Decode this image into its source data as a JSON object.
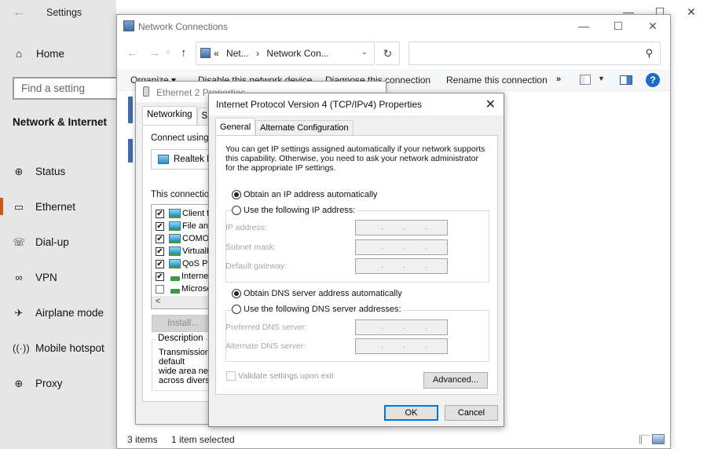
{
  "settings": {
    "title": "Settings",
    "back_icon": "back-arrow-icon",
    "home": {
      "label": "Home",
      "icon": "home-icon"
    },
    "search": {
      "placeholder": "Find a setting"
    },
    "section_title": "Network & Internet",
    "nav": [
      {
        "label": "Status",
        "icon": "globe-monitor-icon",
        "active": false
      },
      {
        "label": "Ethernet",
        "icon": "ethernet-icon",
        "active": true
      },
      {
        "label": "Dial-up",
        "icon": "phone-icon",
        "active": false
      },
      {
        "label": "VPN",
        "icon": "vpn-icon",
        "active": false
      },
      {
        "label": "Airplane mode",
        "icon": "airplane-icon",
        "active": false
      },
      {
        "label": "Mobile hotspot",
        "icon": "hotspot-icon",
        "active": false
      },
      {
        "label": "Proxy",
        "icon": "globe-icon",
        "active": false
      }
    ],
    "accent_color": "#c8581d"
  },
  "network_connections": {
    "title": "Network Connections",
    "window_controls": {
      "minimize": "—",
      "maximize": "☐",
      "close": "✕"
    },
    "nav": {
      "back": "←",
      "forward": "→",
      "recent": "˅",
      "up": "↑"
    },
    "address": {
      "prefix": "«",
      "crumbs": [
        "Net...",
        "›",
        "Network Con..."
      ],
      "dropdown": "⌄",
      "refresh": "↻"
    },
    "search_placeholder": "",
    "commands": {
      "organize": "Organize ▾",
      "disable": "Disable this network device",
      "diagnose": "Diagnose this connection",
      "rename": "Rename this connection",
      "more": "»",
      "help": "?"
    },
    "status": {
      "items": "3 items",
      "selected": "1 item selected"
    }
  },
  "ethernet_properties": {
    "title": "Ethernet 2 Properties",
    "tabs": [
      "Networking",
      "Sharing"
    ],
    "connect_using_label": "Connect using:",
    "adapter": "Realtek PCIe GbE Family Controller",
    "items_label": "This connection uses the following items:",
    "components": [
      {
        "label": "Client for Microsoft Networks",
        "checked": true,
        "type": "net"
      },
      {
        "label": "File and Printer Sharing for Microsoft Networks",
        "checked": true,
        "type": "net"
      },
      {
        "label": "COMODO Internet Security Firewall Driver",
        "checked": true,
        "type": "net"
      },
      {
        "label": "VirtualBox NDIS6 Bridged Networking Driver",
        "checked": true,
        "type": "net"
      },
      {
        "label": "QoS Packet Scheduler",
        "checked": true,
        "type": "net"
      },
      {
        "label": "Internet Protocol Version 4 (TCP/IPv4)",
        "checked": true,
        "type": "proto"
      },
      {
        "label": "Microsoft Network Adapter Multiplexor Protocol",
        "checked": false,
        "type": "proto"
      }
    ],
    "scroll_left": "<",
    "install_button": "Install...",
    "description_label": "Description",
    "description_text": "Transmission Control Protocol/Internet Protocol. The default\nwide area network protocol that provides communication\nacross diverse interconnected networks."
  },
  "ipv4_properties": {
    "title": "Internet Protocol Version 4 (TCP/IPv4) Properties",
    "close": "✕",
    "tabs": [
      "General",
      "Alternate Configuration"
    ],
    "intro": "You can get IP settings assigned automatically if your network supports\nthis capability. Otherwise, you need to ask your network administrator\nfor the appropriate IP settings.",
    "ip_auto": {
      "label": "Obtain an IP address automatically",
      "selected": true
    },
    "ip_manual": {
      "label": "Use the following IP address:",
      "selected": false
    },
    "ip_fields": [
      {
        "label": "IP address:",
        "value": ". . ."
      },
      {
        "label": "Subnet mask:",
        "value": ". . ."
      },
      {
        "label": "Default gateway:",
        "value": ". . ."
      }
    ],
    "dns_auto": {
      "label": "Obtain DNS server address automatically",
      "selected": true
    },
    "dns_manual": {
      "label": "Use the following DNS server addresses:",
      "selected": false
    },
    "dns_fields": [
      {
        "label": "Preferred DNS server:",
        "value": ". . ."
      },
      {
        "label": "Alternate DNS server:",
        "value": ". . ."
      }
    ],
    "validate": {
      "label": "Validate settings upon exit",
      "checked": false
    },
    "advanced_button": "Advanced...",
    "ok_button": "OK",
    "cancel_button": "Cancel",
    "focus_color": "#0078d7"
  }
}
